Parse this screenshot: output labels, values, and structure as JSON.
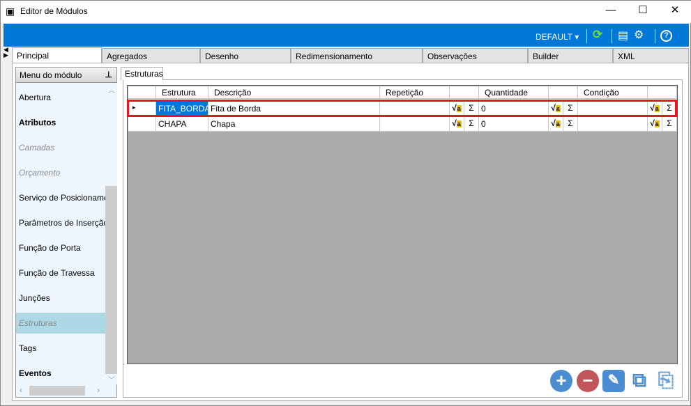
{
  "window": {
    "title": "Editor de Módulos",
    "minimize": "—",
    "maximize": "☐",
    "close": "✕"
  },
  "toolbar": {
    "profile": "DEFAULT ▾",
    "refresh_icon": "⟳",
    "layout_icon": "▤",
    "settings_icon": "⚙",
    "help_icon": "?"
  },
  "tabs": [
    "Principal",
    "Agregados",
    "Desenho",
    "Redimensionamento",
    "Observações",
    "Builder",
    "XML"
  ],
  "sidebar": {
    "title": "Menu do módulo",
    "pin": "⊥",
    "items": [
      {
        "label": "Abertura",
        "style": "normal"
      },
      {
        "label": "Atributos",
        "style": "bold"
      },
      {
        "label": "Camadas",
        "style": "disabled"
      },
      {
        "label": "Orçamento",
        "style": "disabled"
      },
      {
        "label": "Serviço de Posicionamento",
        "style": "normal"
      },
      {
        "label": "Parâmetros de Inserção",
        "style": "normal"
      },
      {
        "label": "Função de Porta",
        "style": "normal"
      },
      {
        "label": "Função de Travessa",
        "style": "normal"
      },
      {
        "label": "Junções",
        "style": "normal"
      },
      {
        "label": "Estruturas",
        "style": "selected"
      },
      {
        "label": "Tags",
        "style": "normal"
      },
      {
        "label": "Eventos",
        "style": "bold"
      }
    ]
  },
  "subtab": "Estruturas",
  "grid": {
    "columns": [
      "Estrutura",
      "Descrição",
      "Repetição",
      "Quantidade",
      "Condição"
    ],
    "rows": [
      {
        "estrutura": "FITA_BORDA",
        "descricao": "Fita de Borda",
        "repeticao": "",
        "quantidade": "0",
        "condicao": "",
        "selected": true
      },
      {
        "estrutura": "CHAPA",
        "descricao": "Chapa",
        "repeticao": "",
        "quantidade": "0",
        "condicao": "",
        "selected": false
      }
    ]
  },
  "icons": {
    "formula": "√a",
    "sum": "Σ",
    "row_pointer": "▸"
  },
  "actions": {
    "add": "+",
    "remove": "−",
    "edit": "✎",
    "copy": "⧉",
    "paste": "⎘"
  },
  "colors": {
    "accent": "#0078d7",
    "highlight": "#e8141c",
    "selected_cell": "#0078d7",
    "menu_selected": "#add8e6"
  }
}
